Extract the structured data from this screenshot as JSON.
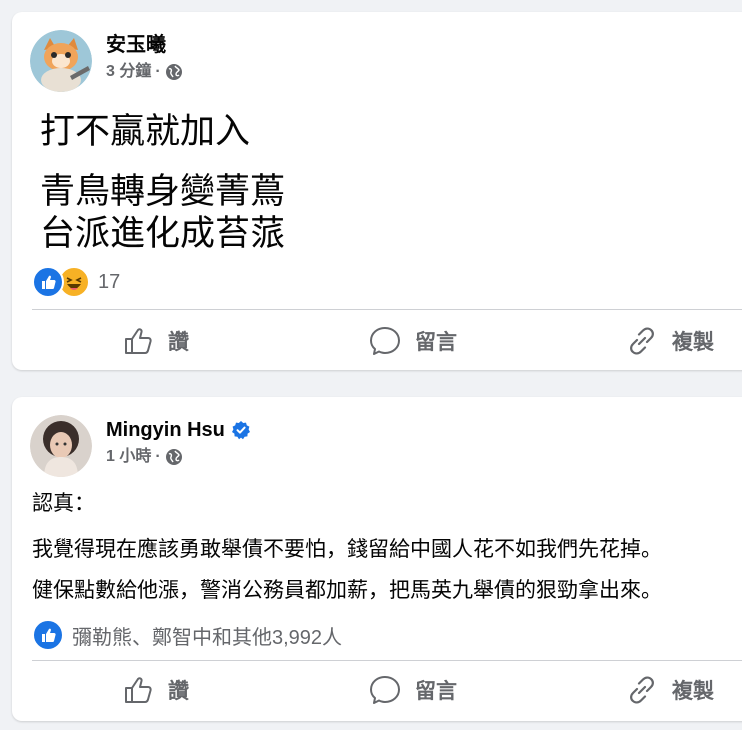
{
  "post1": {
    "author": "安玉曦",
    "time": "3 分鐘",
    "lines": [
      "打不贏就加入",
      "青鳥轉身變菁蔦",
      "台派進化成苔蒎"
    ],
    "reaction_count": "17",
    "actions": {
      "like": "讚",
      "comment": "留言",
      "copy": "複製"
    }
  },
  "post2": {
    "author": "Mingyin Hsu",
    "time": "1 小時",
    "lines": [
      "認真：",
      "我覺得現在應該勇敢舉債不要怕，錢留給中國人花不如我們先花掉。",
      "健保點數給他漲，警消公務員都加薪，把馬英九舉債的狠勁拿出來。"
    ],
    "reactions_text": "彌勒熊、鄭智中和其他3,992人",
    "actions": {
      "like": "讚",
      "comment": "留言",
      "copy": "複製"
    }
  },
  "colors": {
    "like_blue": "#1b74e4",
    "secondary_text": "#65676b",
    "haha_yellow": "#f7b125"
  },
  "icons": [
    "globe-icon",
    "verified-badge-icon",
    "like-icon",
    "comment-icon",
    "copy-link-icon",
    "like-reaction-icon",
    "haha-reaction-icon"
  ]
}
